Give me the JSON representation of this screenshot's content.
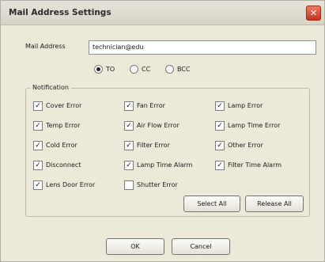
{
  "window": {
    "title": "Mail Address Settings",
    "close_glyph": "✕"
  },
  "mail_address": {
    "label": "Mail Address",
    "value": "technician@edu"
  },
  "recipient_type": {
    "options": [
      "TO",
      "CC",
      "BCC"
    ],
    "selected": "TO"
  },
  "notification": {
    "group_label": "Notification",
    "columns": [
      [
        {
          "label": "Cover Error",
          "checked": true
        },
        {
          "label": "Temp Error",
          "checked": true
        },
        {
          "label": "Cold Error",
          "checked": true
        },
        {
          "label": "Disconnect",
          "checked": true
        },
        {
          "label": "Lens Door Error",
          "checked": true
        }
      ],
      [
        {
          "label": "Fan Error",
          "checked": true
        },
        {
          "label": "Air Flow Error",
          "checked": true
        },
        {
          "label": "Filter Error",
          "checked": true
        },
        {
          "label": "Lamp Time Alarm",
          "checked": true
        },
        {
          "label": "Shutter Error",
          "checked": false
        }
      ],
      [
        {
          "label": "Lamp Error",
          "checked": true
        },
        {
          "label": "Lamp Time Error",
          "checked": true
        },
        {
          "label": "Other Error",
          "checked": true
        },
        {
          "label": "Filter Time Alarm",
          "checked": true
        }
      ]
    ],
    "check_glyph": "✓",
    "select_all_label": "Select All",
    "release_all_label": "Release All"
  },
  "footer": {
    "ok_label": "OK",
    "cancel_label": "Cancel"
  }
}
